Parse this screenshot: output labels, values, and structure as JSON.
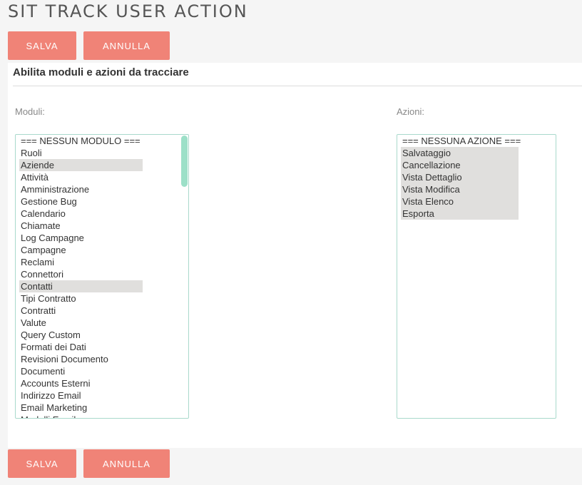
{
  "page": {
    "title": "SIT TRACK USER ACTION"
  },
  "buttons": {
    "save_label": "SALVA",
    "cancel_label": "ANNULLA"
  },
  "panel": {
    "title": "Abilita moduli e azioni da tracciare"
  },
  "moduli": {
    "label": "Moduli:",
    "items": [
      {
        "label": "=== NESSUN MODULO ===",
        "selected": false
      },
      {
        "label": "Ruoli",
        "selected": false
      },
      {
        "label": "Aziende",
        "selected": true
      },
      {
        "label": "Attività",
        "selected": false
      },
      {
        "label": "Amministrazione",
        "selected": false
      },
      {
        "label": "Gestione Bug",
        "selected": false
      },
      {
        "label": "Calendario",
        "selected": false
      },
      {
        "label": "Chiamate",
        "selected": false
      },
      {
        "label": "Log Campagne",
        "selected": false
      },
      {
        "label": "Campagne",
        "selected": false
      },
      {
        "label": "Reclami",
        "selected": false
      },
      {
        "label": "Connettori",
        "selected": false
      },
      {
        "label": "Contatti",
        "selected": true
      },
      {
        "label": "Tipi Contratto",
        "selected": false
      },
      {
        "label": "Contratti",
        "selected": false
      },
      {
        "label": "Valute",
        "selected": false
      },
      {
        "label": "Query Custom",
        "selected": false
      },
      {
        "label": "Formati dei Dati",
        "selected": false
      },
      {
        "label": "Revisioni Documento",
        "selected": false
      },
      {
        "label": "Documenti",
        "selected": false
      },
      {
        "label": "Accounts Esterni",
        "selected": false
      },
      {
        "label": "Indirizzo Email",
        "selected": false
      },
      {
        "label": "Email Marketing",
        "selected": false
      },
      {
        "label": "Modelli Email",
        "selected": false
      }
    ]
  },
  "azioni": {
    "label": "Azioni:",
    "items": [
      {
        "label": "=== NESSUNA AZIONE ===",
        "selected": false
      },
      {
        "label": "Salvataggio",
        "selected": true
      },
      {
        "label": "Cancellazione",
        "selected": true
      },
      {
        "label": "Vista Dettaglio",
        "selected": true
      },
      {
        "label": "Vista Modifica",
        "selected": true
      },
      {
        "label": "Vista Elenco",
        "selected": true
      },
      {
        "label": "Esporta",
        "selected": true
      }
    ]
  },
  "colors": {
    "button_bg": "#f08377",
    "listbox_border": "#a9d9cc",
    "scroll_thumb": "#9ce0c8",
    "selected_bg": "#e0dfdd"
  }
}
